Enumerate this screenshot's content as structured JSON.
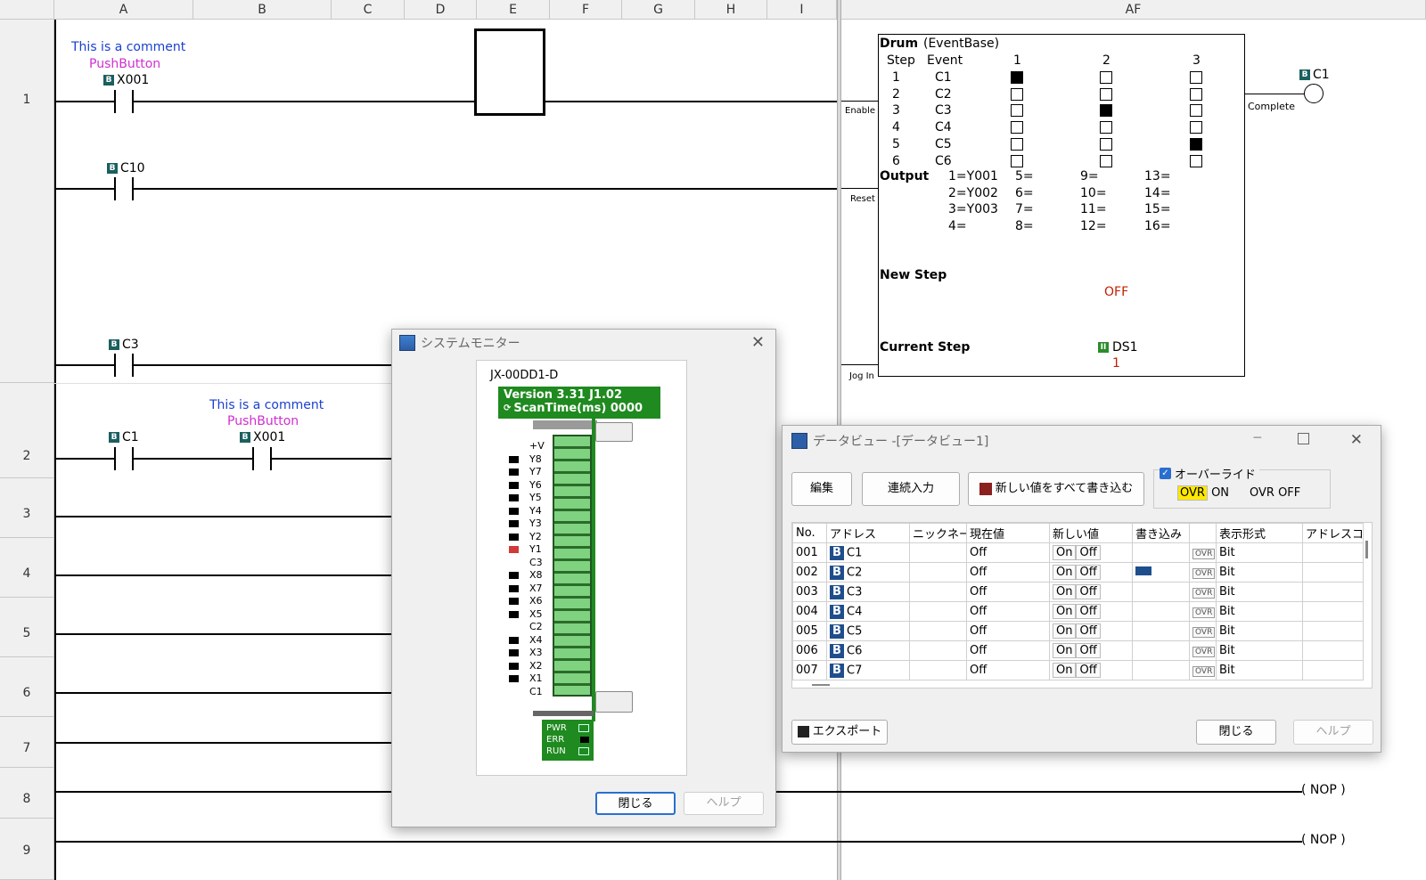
{
  "columns": [
    "A",
    "B",
    "C",
    "D",
    "E",
    "F",
    "G",
    "H",
    "I",
    "AF"
  ],
  "rows": [
    "1",
    "2",
    "3",
    "4",
    "5",
    "6",
    "7",
    "8",
    "9"
  ],
  "ladder": {
    "r1_comment": "This is a comment",
    "r1_tag": "PushButton",
    "r1_addr": "X001",
    "r1b_addr": "C10",
    "r1c_addr": "C3",
    "r2_addr1": "C1",
    "r2_comment": "This is a comment",
    "r2_tag": "PushButton",
    "r2_addr2": "X001",
    "nop1": "( NOP )",
    "nop2": "( NOP )"
  },
  "drum": {
    "title": "Drum",
    "subtitle": "(EventBase)",
    "step_hdr": "Step",
    "event_hdr": "Event",
    "col_hdrs": [
      "1",
      "2",
      "3"
    ],
    "steps": [
      "1",
      "2",
      "3",
      "4",
      "5",
      "6"
    ],
    "events": [
      "C1",
      "C2",
      "C3",
      "C4",
      "C5",
      "C6"
    ],
    "matrix": [
      [
        1,
        0,
        0
      ],
      [
        0,
        0,
        0
      ],
      [
        0,
        1,
        0
      ],
      [
        0,
        0,
        0
      ],
      [
        0,
        0,
        1
      ],
      [
        0,
        0,
        0
      ]
    ],
    "output_lbl": "Output",
    "outputs": [
      [
        "1=Y001",
        "5=",
        "9=",
        "13="
      ],
      [
        "2=Y002",
        "6=",
        "10=",
        "14="
      ],
      [
        "3=Y003",
        "7=",
        "11=",
        "15="
      ],
      [
        "4=",
        "8=",
        "12=",
        "16="
      ]
    ],
    "enable": "Enable",
    "reset": "Reset",
    "jog": "Jog In",
    "complete": "Complete",
    "coil": "C1",
    "new_step": "New Step",
    "new_step_val": "OFF",
    "current_step": "Current Step",
    "ds": "DS1",
    "ds_val": "1"
  },
  "sysmon": {
    "title": "システムモニター",
    "model": "JX-00DD1-D",
    "version": "Version 3.31 J1.02",
    "scan": "ScanTime(ms)  0000",
    "left_labels": [
      "+V",
      "Y8",
      "Y7",
      "Y6",
      "Y5",
      "Y4",
      "Y3",
      "Y2",
      "Y1",
      "C3",
      "X8",
      "X7",
      "X6",
      "X5",
      "C2",
      "X4",
      "X3",
      "X2",
      "X1",
      "C1"
    ],
    "status": [
      "PWR",
      "ERR",
      "RUN"
    ],
    "close": "閉じる",
    "help": "ヘルプ"
  },
  "dataview": {
    "title": "データビュー -[データビュー1]",
    "btn_edit": "編集",
    "btn_cont": "連続入力",
    "btn_writeall": "新しい値をすべて書き込む",
    "override": "オーバーライド",
    "ovr_on_tag": "OVR",
    "ovr_on": "ON",
    "ovr_off_tag": "OVR",
    "ovr_off": "OFF",
    "headers": [
      "No.",
      "アドレス",
      "ニックネーム",
      "現在値",
      "新しい値",
      "書き込み",
      "",
      "表示形式",
      "アドレスコ"
    ],
    "rows": [
      {
        "no": "001",
        "addr": "C1",
        "cur": "Off",
        "fmt": "Bit"
      },
      {
        "no": "002",
        "addr": "C2",
        "cur": "Off",
        "fmt": "Bit"
      },
      {
        "no": "003",
        "addr": "C3",
        "cur": "Off",
        "fmt": "Bit"
      },
      {
        "no": "004",
        "addr": "C4",
        "cur": "Off",
        "fmt": "Bit"
      },
      {
        "no": "005",
        "addr": "C5",
        "cur": "Off",
        "fmt": "Bit"
      },
      {
        "no": "006",
        "addr": "C6",
        "cur": "Off",
        "fmt": "Bit"
      },
      {
        "no": "007",
        "addr": "C7",
        "cur": "Off",
        "fmt": "Bit"
      }
    ],
    "on": "On",
    "off": "Off",
    "ovr": "OVR",
    "export": "エクスポート",
    "close": "閉じる",
    "help": "ヘルプ"
  }
}
